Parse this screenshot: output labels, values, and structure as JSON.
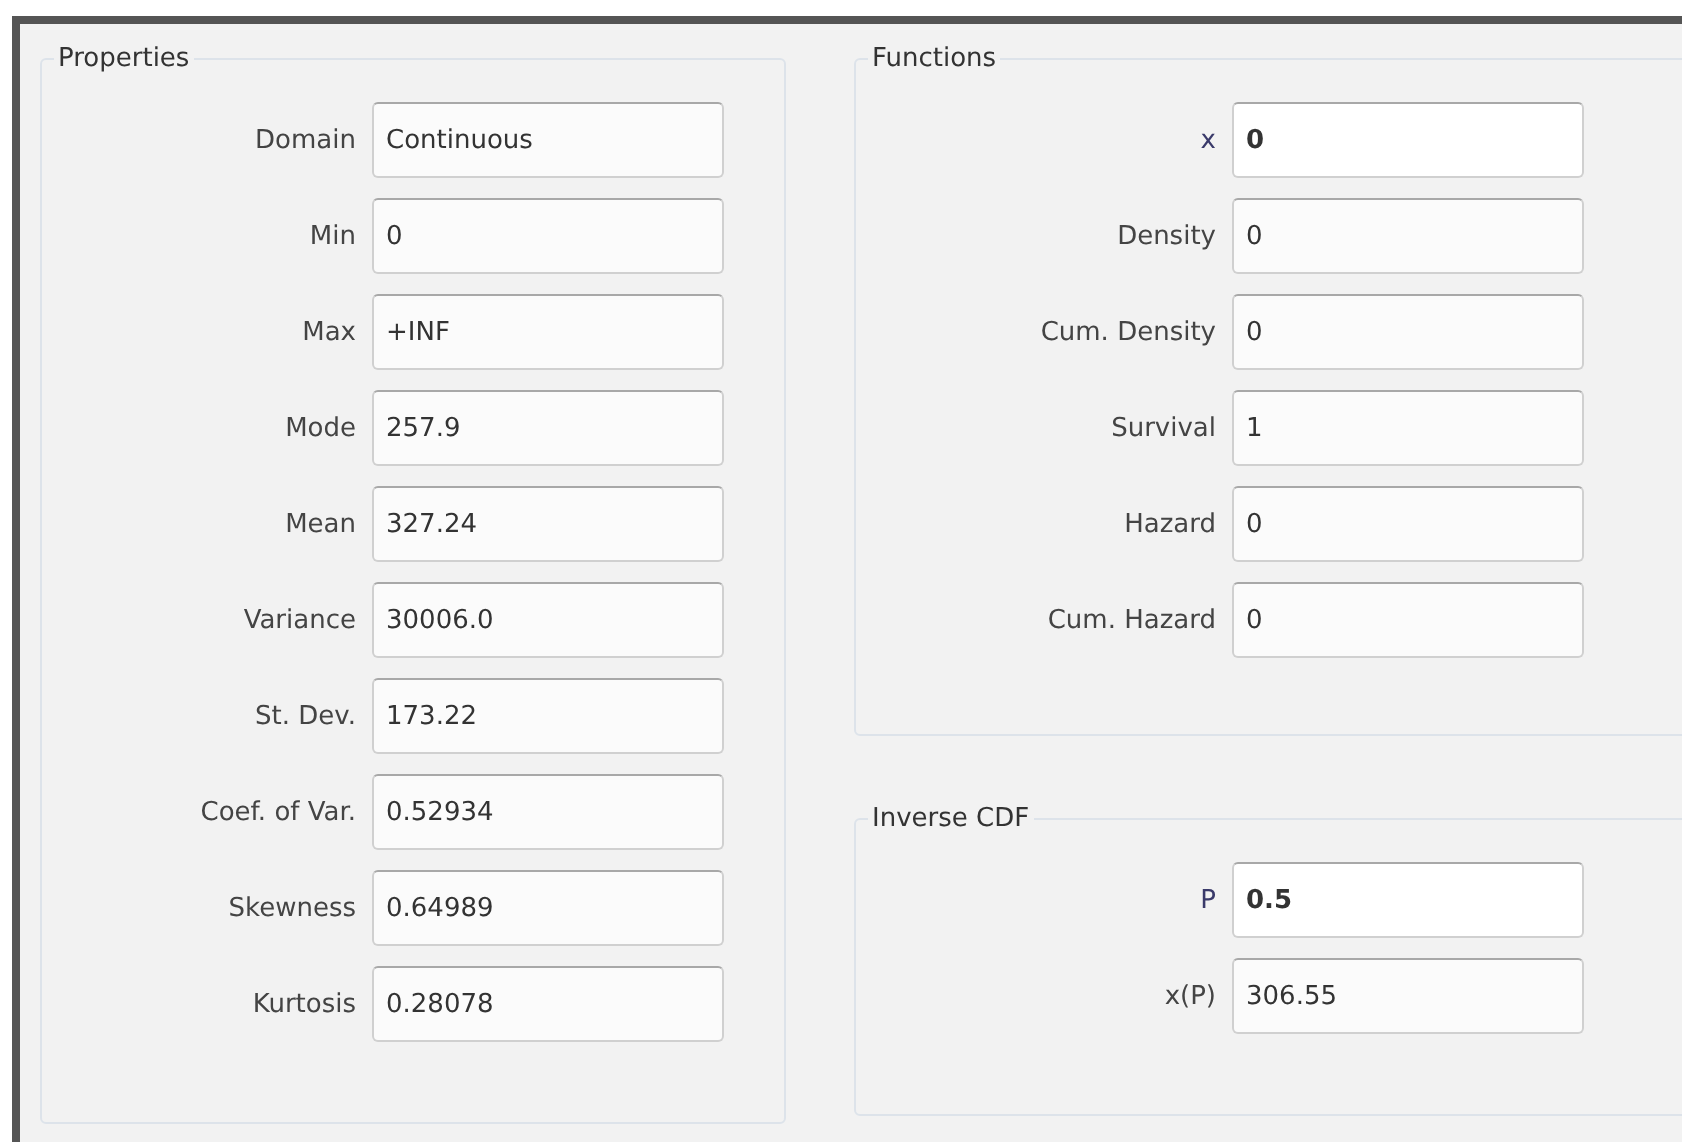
{
  "groups": [
    {
      "title": "Properties",
      "fields": [
        {
          "label": "Domain",
          "value": "Continuous",
          "editable": false
        },
        {
          "label": "Min",
          "value": "0",
          "editable": false
        },
        {
          "label": "Max",
          "value": "+INF",
          "editable": false
        },
        {
          "label": "Mode",
          "value": "257.9",
          "editable": false
        },
        {
          "label": "Mean",
          "value": "327.24",
          "editable": false
        },
        {
          "label": "Variance",
          "value": "30006.0",
          "editable": false
        },
        {
          "label": "St. Dev.",
          "value": "173.22",
          "editable": false
        },
        {
          "label": "Coef. of Var.",
          "value": "0.52934",
          "editable": false
        },
        {
          "label": "Skewness",
          "value": "0.64989",
          "editable": false
        },
        {
          "label": "Kurtosis",
          "value": "0.28078",
          "editable": false
        }
      ]
    },
    {
      "title": "Functions",
      "fields": [
        {
          "label": "x",
          "value": "0",
          "editable": true
        },
        {
          "label": "Density",
          "value": "0",
          "editable": false
        },
        {
          "label": "Cum. Density",
          "value": "0",
          "editable": false
        },
        {
          "label": "Survival",
          "value": "1",
          "editable": false
        },
        {
          "label": "Hazard",
          "value": "0",
          "editable": false
        },
        {
          "label": "Cum. Hazard",
          "value": "0",
          "editable": false
        }
      ]
    },
    {
      "title": "Inverse CDF",
      "fields": [
        {
          "label": "P",
          "value": "0.5",
          "editable": true
        },
        {
          "label": "x(P)",
          "value": "306.55",
          "editable": false
        }
      ]
    }
  ]
}
